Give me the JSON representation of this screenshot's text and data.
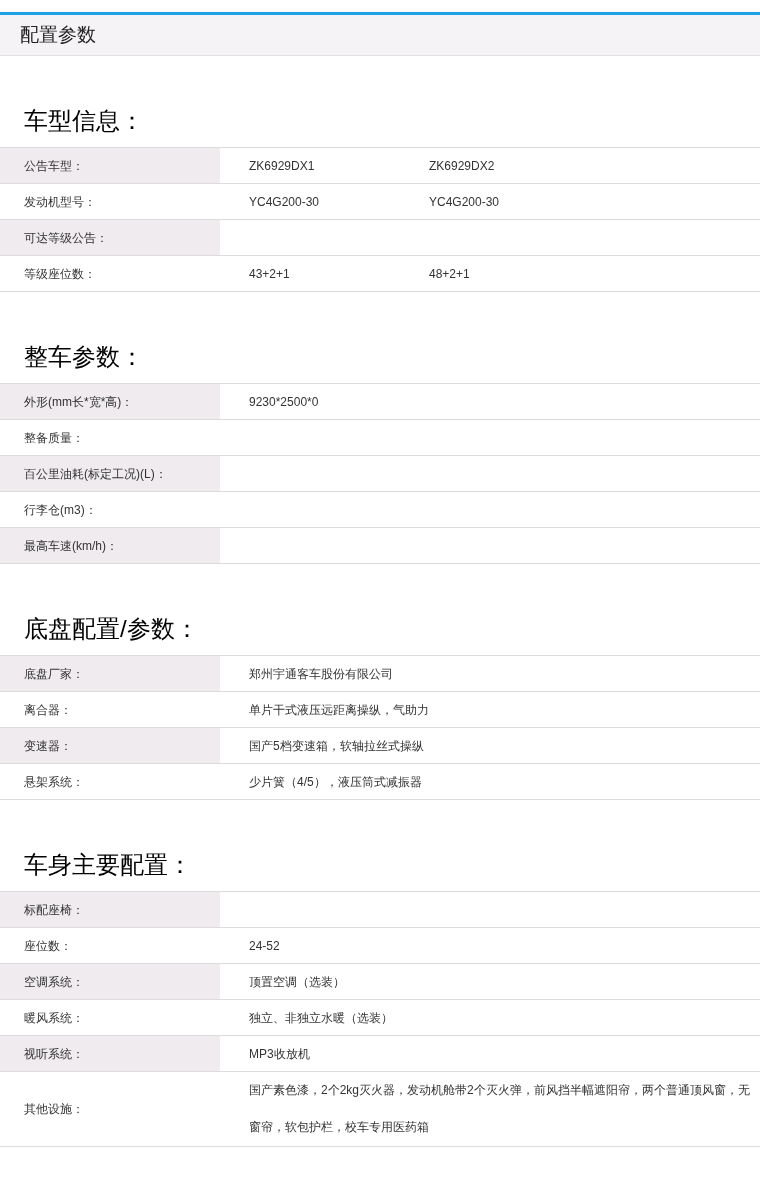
{
  "header": {
    "title": "配置参数"
  },
  "sections": [
    {
      "title": "车型信息：",
      "rows": [
        {
          "label": "公告车型：",
          "values": [
            "ZK6929DX1",
            "ZK6929DX2"
          ]
        },
        {
          "label": "发动机型号：",
          "values": [
            "YC4G200-30",
            "YC4G200-30"
          ]
        },
        {
          "label": "可达等级公告：",
          "values": []
        },
        {
          "label": "等级座位数：",
          "values": [
            "43+2+1",
            "48+2+1"
          ]
        }
      ]
    },
    {
      "title": "整车参数：",
      "rows": [
        {
          "label": "外形(mm长*宽*高)：",
          "values": [
            "9230*2500*0"
          ]
        },
        {
          "label": "整备质量：",
          "values": []
        },
        {
          "label": "百公里油耗(标定工况)(L)：",
          "values": []
        },
        {
          "label": "行李仓(m3)：",
          "values": []
        },
        {
          "label": "最高车速(km/h)：",
          "values": []
        }
      ]
    },
    {
      "title": "底盘配置/参数：",
      "rows": [
        {
          "label": "底盘厂家：",
          "values": [
            "郑州宇通客车股份有限公司"
          ]
        },
        {
          "label": "离合器：",
          "values": [
            "单片干式液压远距离操纵，气助力"
          ]
        },
        {
          "label": "变速器：",
          "values": [
            "国产5档变速箱，软轴拉丝式操纵"
          ]
        },
        {
          "label": "悬架系统：",
          "values": [
            "少片簧（4/5），液压筒式减振器"
          ]
        }
      ]
    },
    {
      "title": "车身主要配置：",
      "rows": [
        {
          "label": "标配座椅：",
          "values": []
        },
        {
          "label": "座位数：",
          "values": [
            "24-52"
          ]
        },
        {
          "label": "空调系统：",
          "values": [
            "顶置空调（选装）"
          ]
        },
        {
          "label": "暖风系统：",
          "values": [
            "独立、非独立水暖（选装）"
          ]
        },
        {
          "label": "视听系统：",
          "values": [
            "MP3收放机"
          ]
        },
        {
          "label": "其他设施：",
          "values": [
            "国产素色漆，2个2kg灭火器，发动机舱带2个灭火弹，前风挡半幅遮阳帘，两个普通顶风窗，无窗帘，软包护栏，校车专用医药箱"
          ]
        }
      ]
    }
  ]
}
